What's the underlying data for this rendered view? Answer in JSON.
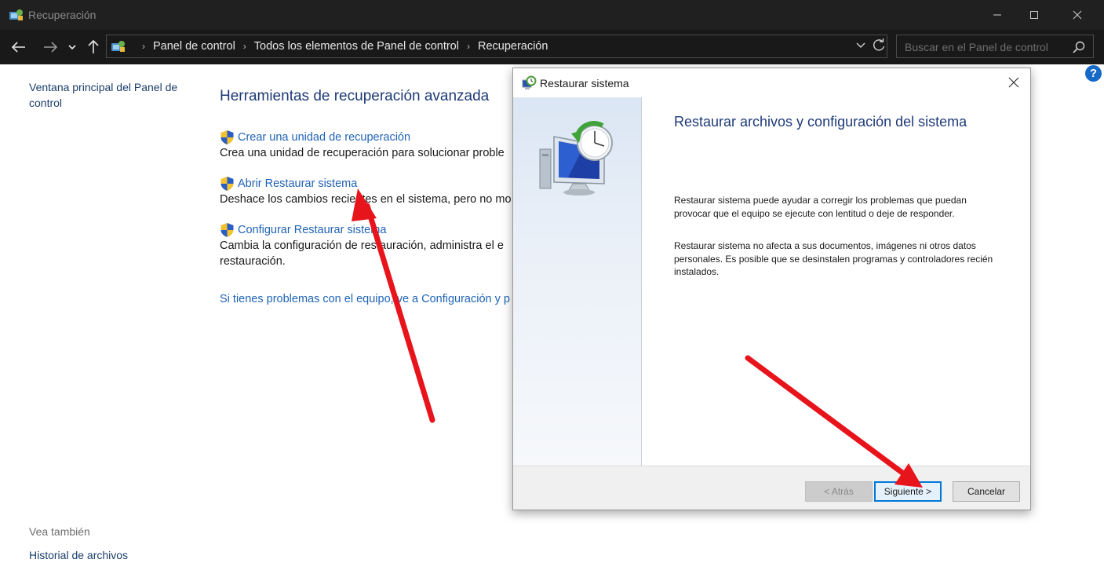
{
  "window": {
    "title": "Recuperación",
    "controls": {
      "minimize": "minimize-icon",
      "maximize": "maximize-icon",
      "close": "close-icon"
    }
  },
  "address": {
    "breadcrumbs": [
      "Panel de control",
      "Todos los elementos de Panel de control",
      "Recuperación"
    ],
    "search_placeholder": "Buscar en el Panel de control"
  },
  "sidebar": {
    "main_link": "Ventana principal del Panel de control",
    "see_also_label": "Vea también",
    "see_also_items": [
      "Historial de archivos"
    ]
  },
  "main": {
    "heading": "Herramientas de recuperación avanzada",
    "tasks": [
      {
        "link": "Crear una unidad de recuperación",
        "desc": [
          "Crea una unidad de recuperación para solucionar proble"
        ]
      },
      {
        "link": "Abrir Restaurar sistema",
        "desc": [
          "Deshace los cambios recientes en el sistema, pero no mo"
        ]
      },
      {
        "link": "Configurar Restaurar sistema",
        "desc": [
          "Cambia la configuración de restauración, administra el e",
          "restauración."
        ]
      }
    ],
    "footer_link": "Si tienes problemas con el equipo, ve a Configuración y p"
  },
  "help": {
    "label": "?"
  },
  "dialog": {
    "title": "Restaurar sistema",
    "heading": "Restaurar archivos y configuración del sistema",
    "paragraphs": [
      "Restaurar sistema puede ayudar a corregir los problemas que puedan provocar que el equipo se ejecute con lentitud o deje de responder.",
      "Restaurar sistema no afecta a sus documentos, imágenes ni otros datos personales. Es posible que se desinstalen programas y controladores recién instalados."
    ],
    "buttons": {
      "back": "< Atrás",
      "next": "Siguiente >",
      "cancel": "Cancelar"
    }
  },
  "colors": {
    "titlebar": "#202020",
    "heading_blue": "#1e3a78",
    "link_blue": "#1f63b6",
    "annotation_red": "#e8141c"
  }
}
